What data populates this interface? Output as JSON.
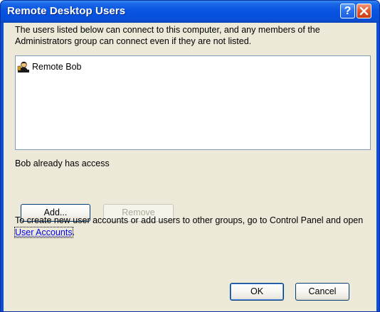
{
  "window": {
    "title": "Remote Desktop Users",
    "help_glyph": "?"
  },
  "dialog": {
    "description": "The users listed below can connect to this computer, and any members of the Administrators group can connect even if they are not listed.",
    "users": [
      {
        "name": "Remote Bob",
        "icon": "user-icon"
      }
    ],
    "status_text": "Bob already has access",
    "add_label": "Add...",
    "remove_label": "Remove",
    "info_text_before": "To create new user accounts or add users to other groups, go to Control Panel and open ",
    "info_link": "User Accounts",
    "info_text_after": ".",
    "ok_label": "OK",
    "cancel_label": "Cancel"
  },
  "colors": {
    "titlebar": "#0a56e0",
    "client_bg": "#ece9d8",
    "close_button": "#e35a2f",
    "link": "#0000ee"
  }
}
